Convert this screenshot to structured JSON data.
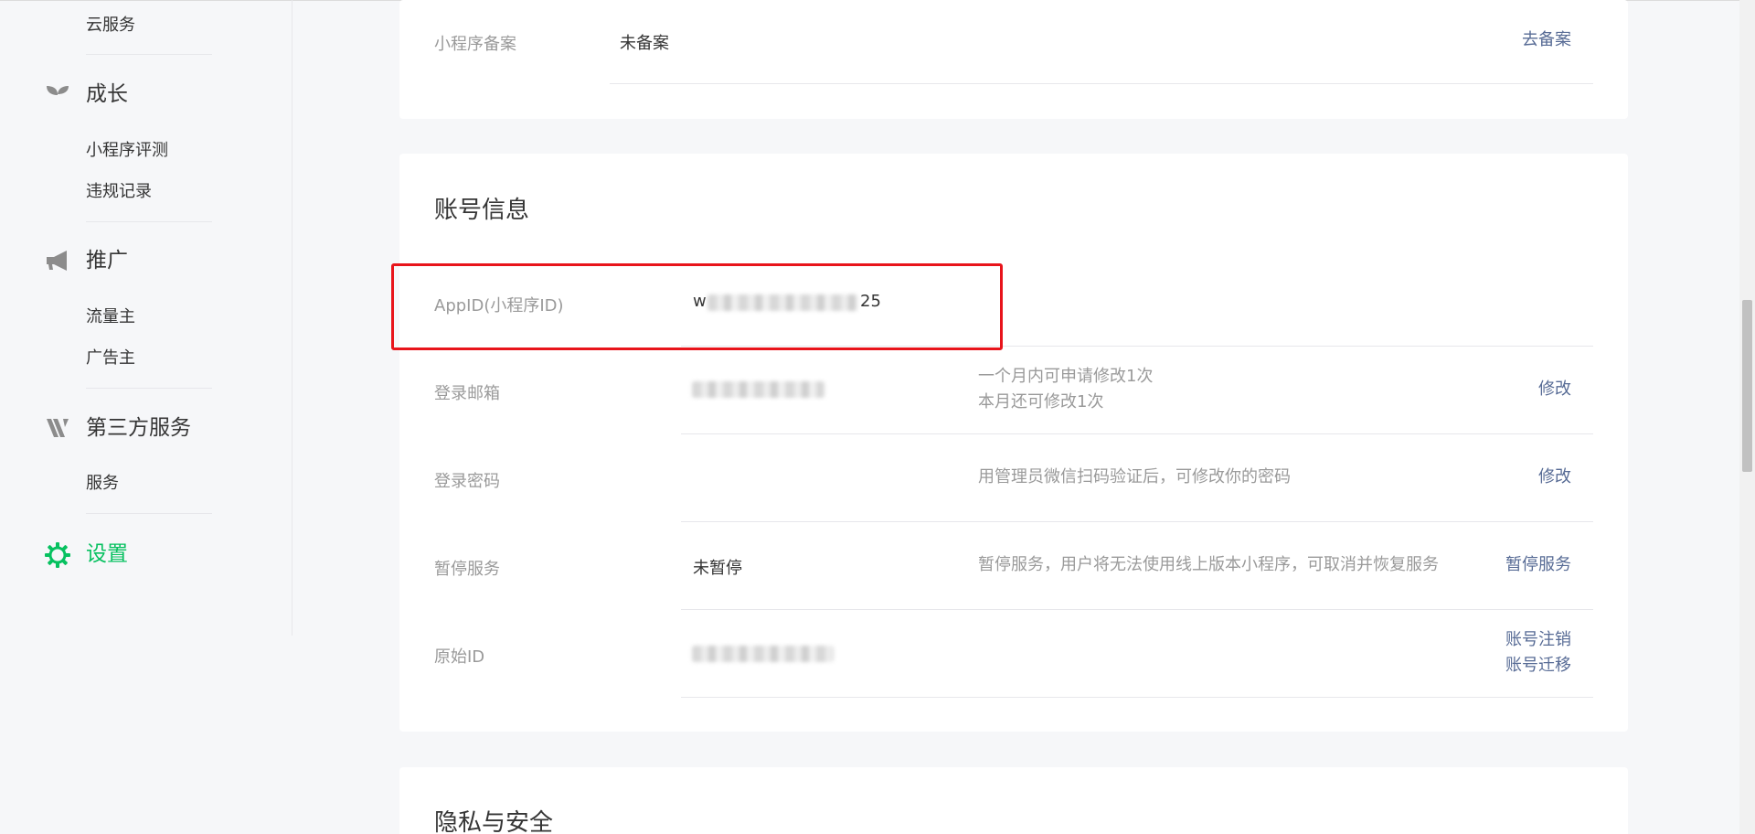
{
  "sidebar": {
    "cloud_service": "云服务",
    "growth": {
      "label": "成长",
      "icon": "sprout-icon",
      "items": [
        "小程序评测",
        "违规记录"
      ]
    },
    "promotion": {
      "label": "推广",
      "icon": "megaphone-icon",
      "items": [
        "流量主",
        "广告主"
      ]
    },
    "third_party": {
      "label": "第三方服务",
      "icon": "third-party-icon",
      "items": [
        "服务"
      ]
    },
    "settings": {
      "label": "设置",
      "icon": "gear-icon",
      "active_color": "#07c160"
    }
  },
  "filing_card": {
    "label": "小程序备案",
    "value": "未备案",
    "action": "去备案"
  },
  "account_card": {
    "title": "账号信息",
    "appid": {
      "label": "AppID(小程序ID)",
      "value_prefix": "w",
      "value_suffix": "25"
    },
    "email": {
      "label": "登录邮箱",
      "desc_line1": "一个月内可申请修改1次",
      "desc_line2": "本月还可修改1次",
      "action": "修改"
    },
    "password": {
      "label": "登录密码",
      "desc": "用管理员微信扫码验证后，可修改你的密码",
      "action": "修改"
    },
    "suspend": {
      "label": "暂停服务",
      "value": "未暂停",
      "desc": "暂停服务，用户将无法使用线上版本小程序，可取消并恢复服务",
      "action": "暂停服务"
    },
    "origin_id": {
      "label": "原始ID",
      "action1": "账号注销",
      "action2": "账号迁移"
    }
  },
  "privacy_card": {
    "title": "隐私与安全"
  },
  "colors": {
    "link": "#576b95",
    "highlight": "#e8141b",
    "accent": "#07c160"
  }
}
